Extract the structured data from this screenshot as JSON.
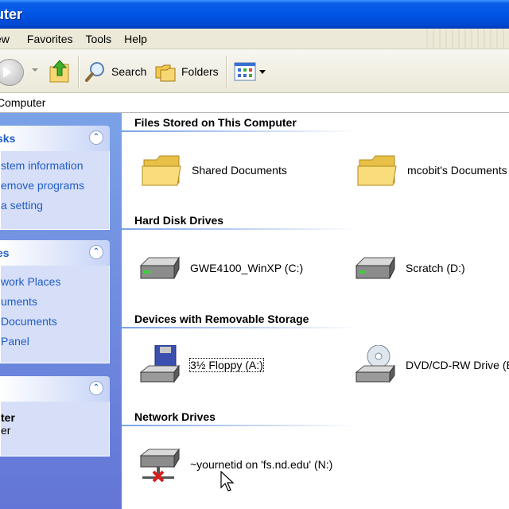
{
  "window": {
    "title": "uter"
  },
  "menu": {
    "items": [
      "ew",
      "Favorites",
      "Tools",
      "Help"
    ]
  },
  "toolbar": {
    "search_label": "Search",
    "folders_label": "Folders"
  },
  "address": {
    "value": "Computer"
  },
  "tasks": {
    "system_panel": {
      "title": "sks",
      "links": [
        "stem information",
        "emove programs",
        "a setting"
      ]
    },
    "places_panel": {
      "title": "es",
      "links": [
        "work Places",
        "uments",
        "Documents",
        "Panel"
      ]
    },
    "details_panel": {
      "title_line": "ter",
      "sub_line": "er"
    }
  },
  "sections": [
    {
      "header": "Files Stored on This Computer",
      "items": [
        {
          "label": "Shared Documents",
          "icon": "folder-icon"
        },
        {
          "label": "mcobit's Documents",
          "icon": "folder-icon"
        }
      ]
    },
    {
      "header": "Hard Disk Drives",
      "items": [
        {
          "label": "GWE4100_WinXP (C:)",
          "icon": "hard-drive-icon"
        },
        {
          "label": "Scratch (D:)",
          "icon": "hard-drive-icon"
        }
      ]
    },
    {
      "header": "Devices with Removable Storage",
      "items": [
        {
          "label": "3½ Floppy (A:)",
          "icon": "floppy-drive-icon"
        },
        {
          "label": "DVD/CD-RW Drive (E:",
          "icon": "cd-drive-icon"
        }
      ]
    },
    {
      "header": "Network Drives",
      "items": [
        {
          "label": "~yournetid on 'fs.nd.edu' (N:)",
          "icon": "disconnected-network-drive-icon"
        }
      ]
    }
  ],
  "colors": {
    "titlebar": "#0055e5",
    "taskpane": "#6d8ee0",
    "link": "#215dc6",
    "chrome": "#ece9d8"
  }
}
